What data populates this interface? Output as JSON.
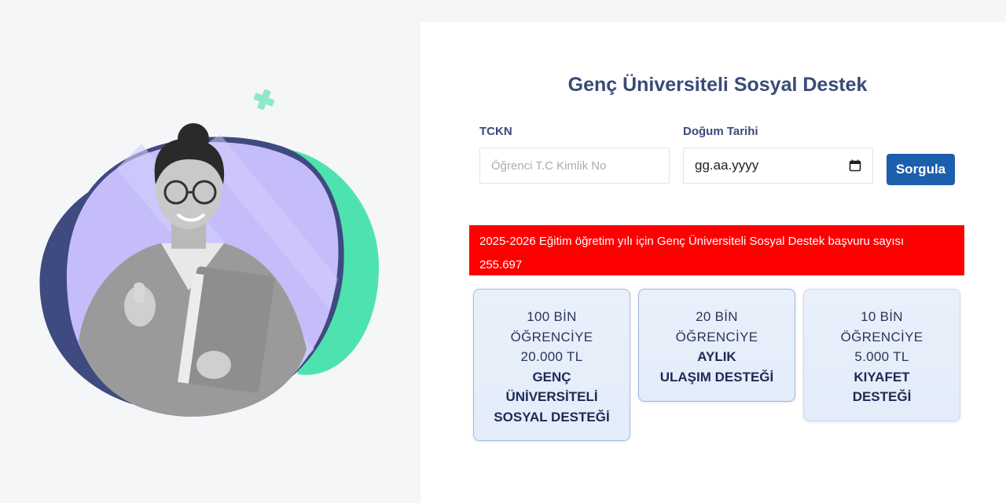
{
  "header": {
    "title": "Genç Üniversiteli Sosyal Destek"
  },
  "form": {
    "tckn_label": "TCKN",
    "tckn_placeholder": "Öğrenci T.C Kimlik No",
    "tckn_value": "",
    "birth_label": "Doğum Tarihi",
    "birth_placeholder": "gg.aa.yyyy",
    "submit_label": "Sorgula"
  },
  "notice": {
    "text": "2025-2026 Eğitim öğretim yılı için Genç Üniversiteli Sosyal Destek başvuru sayısı",
    "count": "255.697"
  },
  "cards": [
    {
      "lines": [
        "100 BİN",
        "ÖĞRENCİYE",
        "20.000 TL"
      ],
      "strong": [
        "GENÇ",
        "ÜNİVERSİTELİ",
        "SOSYAL DESTEĞİ"
      ]
    },
    {
      "lines": [
        "20 BİN",
        "ÖĞRENCİYE"
      ],
      "strong": [
        "AYLIK",
        "ULAŞIM DESTEĞİ"
      ]
    },
    {
      "lines": [
        "10 BİN",
        "ÖĞRENCİYE",
        "5.000 TL"
      ],
      "strong": [
        "KIYAFET",
        "DESTEĞİ"
      ]
    }
  ],
  "icons": {
    "calendar": "calendar-icon",
    "decoration": "plus-icon"
  },
  "colors": {
    "accent": "#1c5fad",
    "title": "#3a4a78",
    "notice_bg": "#ff0000",
    "blob_navy": "#3f4a80",
    "blob_green": "#4ee3ae",
    "blob_lavender": "#c4bdfa"
  }
}
